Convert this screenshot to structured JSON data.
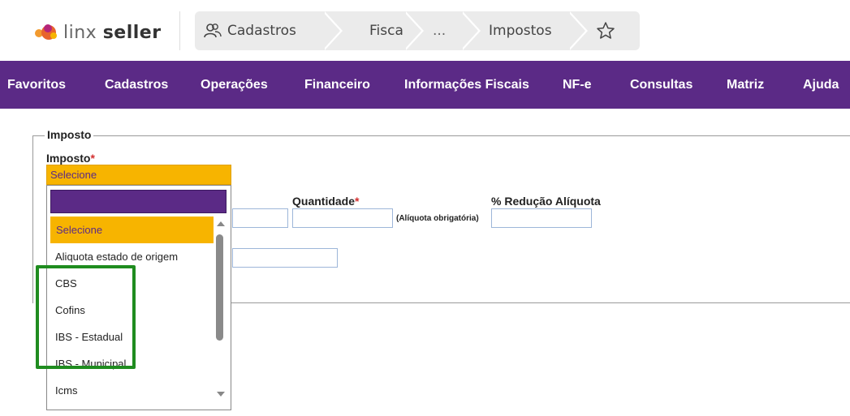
{
  "header": {
    "logo_light": "linx",
    "logo_bold": "seller",
    "breadcrumbs": [
      "Cadastros",
      "Fiscal",
      "...",
      "Impostos"
    ],
    "icons": [
      "users-icon",
      "star-icon"
    ]
  },
  "menu": [
    "Favoritos",
    "Cadastros",
    "Operações",
    "Financeiro",
    "Informações Fiscais",
    "NF-e",
    "Consultas",
    "Matriz",
    "Ajuda"
  ],
  "form": {
    "legend": "Imposto",
    "imposto_label": "Imposto",
    "required_mark": "*",
    "selected_value": "Selecione",
    "quantidade_label": "Quantidade",
    "aliquota_note": "(Alíquota obrigatória)",
    "reducao_label": "% Redução Alíquota"
  },
  "dropdown": {
    "options": [
      "Selecione",
      "Aliquota estado de origem",
      "CBS",
      "Cofins",
      "IBS - Estadual",
      "IBS - Municipal",
      "Icms",
      "-"
    ]
  },
  "colors": {
    "brand_purple": "#5b2a86",
    "accent_yellow": "#f7b400",
    "highlight_green": "#1f8c1f"
  }
}
